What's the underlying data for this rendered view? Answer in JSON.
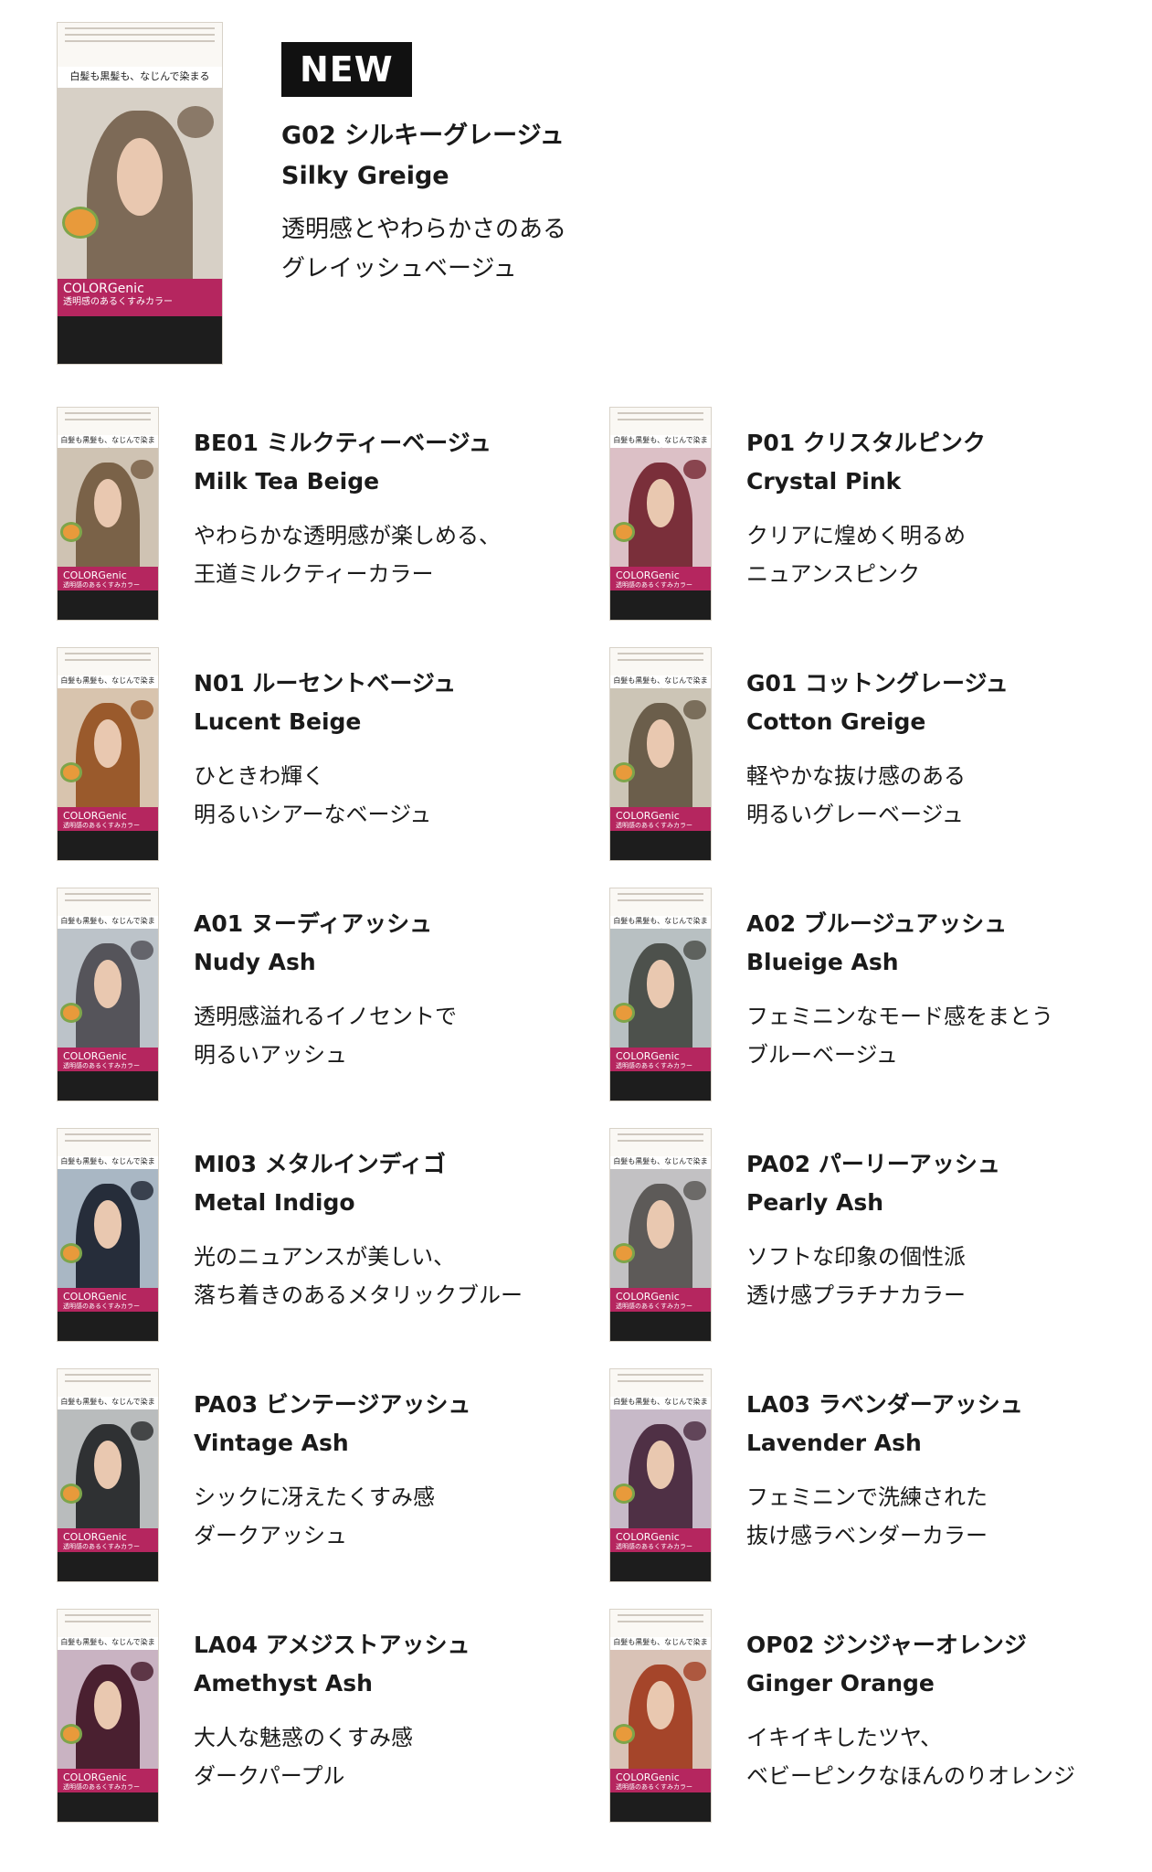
{
  "hero": {
    "badge": "NEW",
    "name_jp": "G02 シルキーグレージュ",
    "name_en": "Silky Greige",
    "desc": [
      "透明感とやわらかさのある",
      "グレイッシュベージュ"
    ],
    "box": {
      "tag": "白髪も黒髪も、なじんで染まる",
      "brand": "COLORGenic",
      "sub": "透明感のあるくすみカラー",
      "bg": "#d7d0c6",
      "hair": "#7d6a57",
      "band": "#b5265f"
    }
  },
  "items": [
    {
      "name_jp": "BE01 ミルクティーベージュ",
      "name_en": "Milk Tea Beige",
      "desc": [
        "やわらかな透明感が楽しめる、",
        "王道ミルクティーカラー"
      ],
      "box": {
        "bg": "#cfc3b3",
        "hair": "#7a6248",
        "band": "#b5265f"
      }
    },
    {
      "name_jp": "P01 クリスタルピンク",
      "name_en": "Crystal Pink",
      "desc": [
        "クリアに煌めく明るめ",
        "ニュアンスピンク"
      ],
      "box": {
        "bg": "#dcc0c6",
        "hair": "#7a2f3a",
        "band": "#b5265f"
      }
    },
    {
      "name_jp": "N01 ルーセントベージュ",
      "name_en": "Lucent Beige",
      "desc": [
        "ひときわ輝く",
        "明るいシアーなベージュ"
      ],
      "box": {
        "bg": "#d8c4ae",
        "hair": "#9a5a2c",
        "band": "#b5265f"
      }
    },
    {
      "name_jp": "G01 コットングレージュ",
      "name_en": "Cotton Greige",
      "desc": [
        "軽やかな抜け感のある",
        "明るいグレーベージュ"
      ],
      "box": {
        "bg": "#ccc5b6",
        "hair": "#6b5e4b",
        "band": "#b5265f"
      }
    },
    {
      "name_jp": "A01 ヌーディアッシュ",
      "name_en": "Nudy Ash",
      "desc": [
        "透明感溢れるイノセントで",
        "明るいアッシュ"
      ],
      "box": {
        "bg": "#bcc3c9",
        "hair": "#55545a",
        "band": "#b5265f"
      }
    },
    {
      "name_jp": "A02 ブルージュアッシュ",
      "name_en": "Blueige Ash",
      "desc": [
        "フェミニンなモード感をまとう",
        "ブルーベージュ"
      ],
      "box": {
        "bg": "#b8c0c2",
        "hair": "#4d514c",
        "band": "#b5265f"
      }
    },
    {
      "name_jp": "MI03 メタルインディゴ",
      "name_en": "Metal Indigo",
      "desc": [
        "光のニュアンスが美しい、",
        "落ち着きのあるメタリックブルー"
      ],
      "box": {
        "bg": "#a9b7c4",
        "hair": "#262d3a",
        "band": "#b5265f"
      }
    },
    {
      "name_jp": "PA02 パーリーアッシュ",
      "name_en": "Pearly Ash",
      "desc": [
        "ソフトな印象の個性派",
        "透け感プラチナカラー"
      ],
      "box": {
        "bg": "#c2c1c3",
        "hair": "#5d5a58",
        "band": "#b5265f"
      }
    },
    {
      "name_jp": "PA03 ビンテージアッシュ",
      "name_en": "Vintage Ash",
      "desc": [
        "シックに冴えたくすみ感",
        "ダークアッシュ"
      ],
      "box": {
        "bg": "#b9bcbd",
        "hair": "#2f3133",
        "band": "#b5265f"
      }
    },
    {
      "name_jp": "LA03 ラベンダーアッシュ",
      "name_en": "Lavender Ash",
      "desc": [
        "フェミニンで洗練された",
        "抜け感ラベンダーカラー"
      ],
      "box": {
        "bg": "#c7b9c8",
        "hair": "#4f3045",
        "band": "#b5265f"
      }
    },
    {
      "name_jp": "LA04 アメジストアッシュ",
      "name_en": "Amethyst Ash",
      "desc": [
        "大人な魅惑のくすみ感",
        "ダークパープル"
      ],
      "box": {
        "bg": "#c9b3c2",
        "hair": "#4a2030",
        "band": "#b5265f"
      }
    },
    {
      "name_jp": "OP02 ジンジャーオレンジ",
      "name_en": "Ginger Orange",
      "desc": [
        "イキイキしたツヤ、",
        "ベビーピンクなほんのりオレンジ"
      ],
      "box": {
        "bg": "#d9c2b6",
        "hair": "#a5452a",
        "band": "#b5265f"
      }
    }
  ]
}
